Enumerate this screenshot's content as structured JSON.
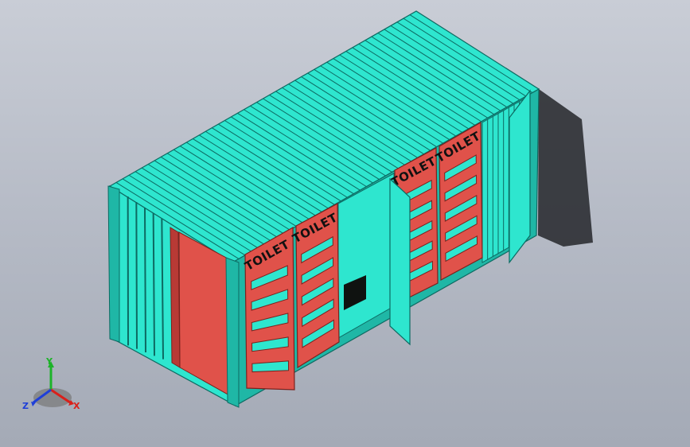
{
  "scene": {
    "model": "toilet-container",
    "view": "isometric",
    "background_top": "#c9cdd6",
    "background_bottom": "#a4aab6"
  },
  "container": {
    "body_color": "#2ee6cf",
    "body_shade": "#1fb7a6",
    "door_color": "#e0524a",
    "door_dark": "#b83a35",
    "floor_color": "#0f1210",
    "shadow_color": "#2c2f33"
  },
  "panels": {
    "label": "TOILET"
  },
  "triad": {
    "x_label": "X",
    "y_label": "Y",
    "z_label": "Z",
    "x_color": "#d9201a",
    "y_color": "#1db329",
    "z_color": "#1f3fd8"
  }
}
